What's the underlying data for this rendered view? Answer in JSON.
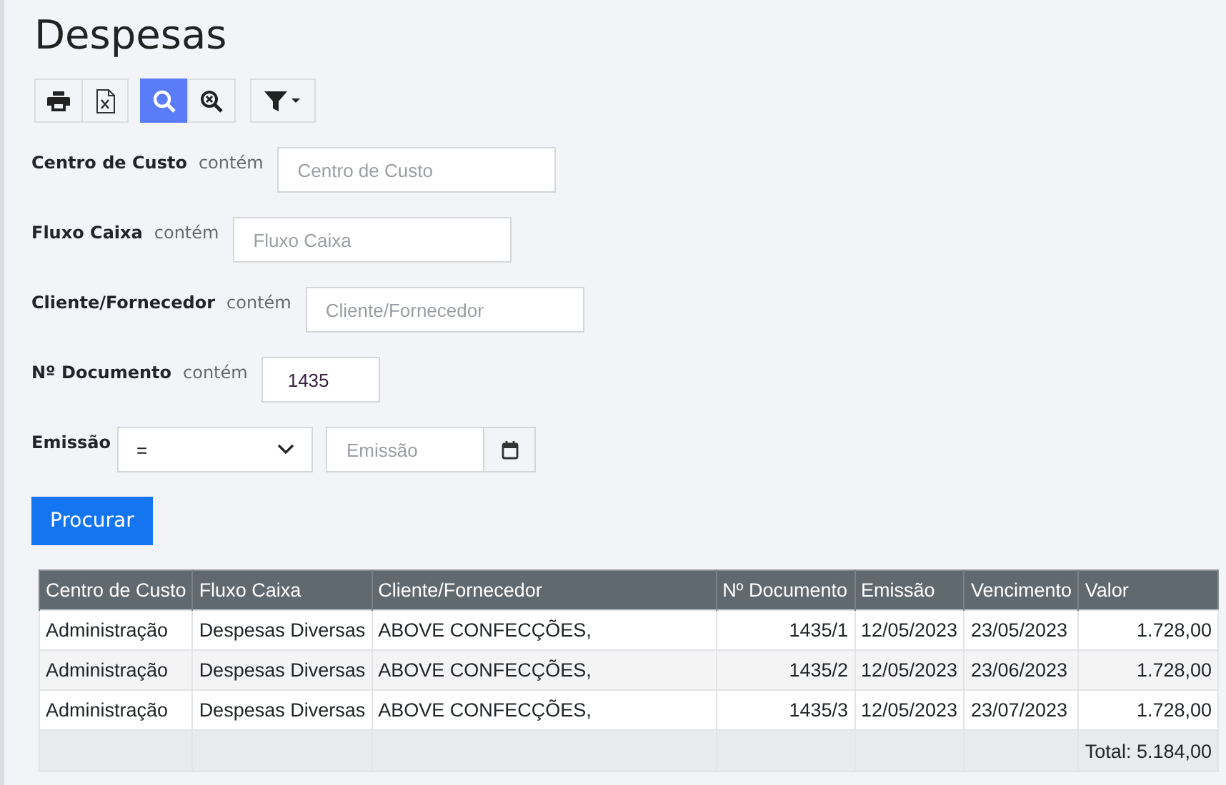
{
  "page": {
    "title": "Despesas"
  },
  "toolbar": [
    {
      "kind": "print",
      "selected": false
    },
    {
      "kind": "excel",
      "selected": false
    },
    {
      "kind": "search",
      "selected": true
    },
    {
      "kind": "clear-search",
      "selected": false
    },
    {
      "kind": "filter",
      "selected": false
    }
  ],
  "filters": [
    {
      "kind": "text",
      "label": "Centro de Custo",
      "operator": "contém",
      "placeholder": "Centro de Custo"
    },
    {
      "kind": "text",
      "label": "Fluxo Caixa",
      "operator": "contém",
      "placeholder": "Fluxo Caixa"
    },
    {
      "kind": "text",
      "label": "Cliente/Fornecedor",
      "operator": "contém",
      "placeholder": "Cliente/Fornecedor"
    },
    {
      "kind": "text",
      "label": "Nº Documento",
      "operator": "contém",
      "value": "1435"
    },
    {
      "kind": "date",
      "label": "Emissão",
      "operator": "=",
      "placeholder": "Emissão"
    }
  ],
  "search_button": "Procurar",
  "table": {
    "columns": [
      "Centro de Custo",
      "Fluxo Caixa",
      "Cliente/Fornecedor",
      "Nº Documento",
      "Emissão",
      "Vencimento",
      "Valor"
    ],
    "rows": [
      [
        "Administração",
        "Despesas Diversas",
        "ABOVE CONFECÇÕES,",
        "1435/1",
        "12/05/2023",
        "23/05/2023",
        "1.728,00"
      ],
      [
        "Administração",
        "Despesas Diversas",
        "ABOVE CONFECÇÕES,",
        "1435/2",
        "12/05/2023",
        "23/06/2023",
        "1.728,00"
      ],
      [
        "Administração",
        "Despesas Diversas",
        "ABOVE CONFECÇÕES,",
        "1435/3",
        "12/05/2023",
        "23/07/2023",
        "1.728,00"
      ]
    ],
    "total": "Total: 5.184,00"
  }
}
